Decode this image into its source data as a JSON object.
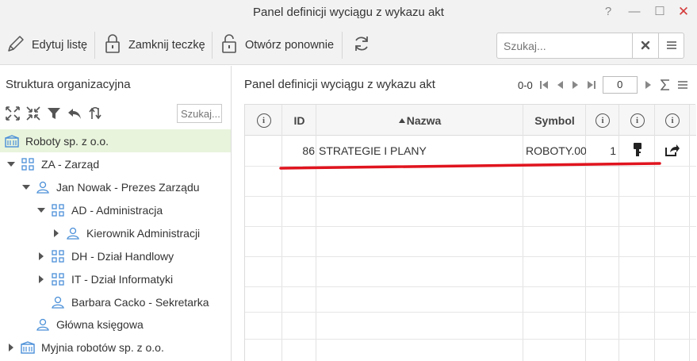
{
  "window": {
    "title": "Panel definicji wyciągu z wykazu akt",
    "help": "?",
    "minimize": "—",
    "maximize": "☐",
    "close": "✕"
  },
  "toolbar": {
    "edit_list": "Edytuj listę",
    "close_folder": "Zamknij teczkę",
    "reopen": "Otwórz ponownie",
    "search_placeholder": "Szukaj..."
  },
  "left": {
    "title": "Struktura organizacyjna",
    "search_placeholder": "Szukaj...",
    "tree": [
      {
        "label": "Roboty sp. z o.o.",
        "type": "company",
        "level": 0,
        "arrow": "none",
        "selected": true
      },
      {
        "label": "ZA - Zarząd",
        "type": "unit",
        "level": 0,
        "arrow": "down"
      },
      {
        "label": "Jan Nowak - Prezes Zarządu",
        "type": "person",
        "level": 1,
        "arrow": "down"
      },
      {
        "label": "AD - Administracja",
        "type": "unit",
        "level": 2,
        "arrow": "down"
      },
      {
        "label": "Kierownik Administracji",
        "type": "person",
        "level": 3,
        "arrow": "right"
      },
      {
        "label": "DH - Dział Handlowy",
        "type": "unit",
        "level": 2,
        "arrow": "right"
      },
      {
        "label": "IT - Dział Informatyki",
        "type": "unit",
        "level": 2,
        "arrow": "right"
      },
      {
        "label": "Barbara Cacko - Sekretarka",
        "type": "person",
        "level": 2,
        "arrow": "none"
      },
      {
        "label": "Główna księgowa",
        "type": "person",
        "level": 1,
        "arrow": "none"
      },
      {
        "label": "Myjnia robotów sp. z o.o.",
        "type": "company",
        "level": 0,
        "arrow": "right"
      }
    ]
  },
  "right": {
    "title": "Panel definicji wyciągu z wykazu akt",
    "pager": {
      "range": "0-0",
      "page": "0"
    },
    "columns": {
      "id": "ID",
      "name": "Nazwa",
      "symbol": "Symbol"
    },
    "rows": [
      {
        "id": "86",
        "name": "STRATEGIE I PLANY",
        "symbol": "ROBOTY.00",
        "count": "1"
      }
    ]
  },
  "colors": {
    "selected_row": "#e8f4dc",
    "annotation_line": "#e0141e",
    "icon_blue": "#4a8fd8"
  }
}
